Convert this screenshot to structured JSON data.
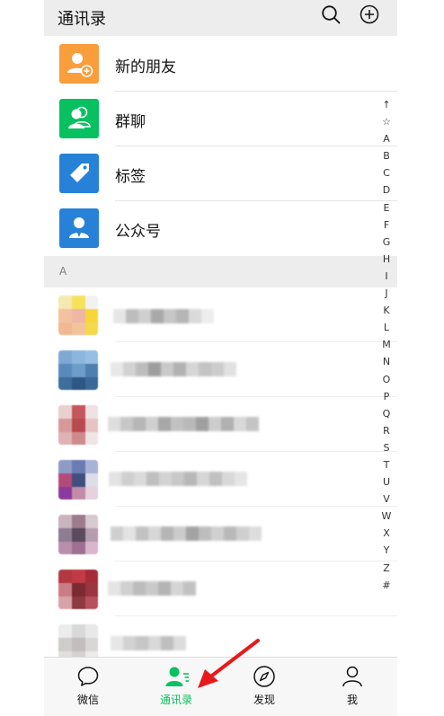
{
  "header": {
    "title": "通讯录",
    "search_icon": "search-icon",
    "add_icon": "add-circle-icon"
  },
  "functions": [
    {
      "label": "新的朋友",
      "color": "#fa9d3b",
      "icon": "add-friend-icon"
    },
    {
      "label": "群聊",
      "color": "#07c160",
      "icon": "group-icon"
    },
    {
      "label": "标签",
      "color": "#2782d7",
      "icon": "tag-icon"
    },
    {
      "label": "公众号",
      "color": "#2782d7",
      "icon": "official-account-icon"
    }
  ],
  "section": {
    "letter": "A"
  },
  "index_bar": [
    "↑",
    "☆",
    "A",
    "B",
    "C",
    "D",
    "E",
    "F",
    "G",
    "H",
    "I",
    "J",
    "K",
    "L",
    "M",
    "N",
    "O",
    "P",
    "Q",
    "R",
    "S",
    "T",
    "U",
    "V",
    "W",
    "X",
    "Y",
    "Z",
    "#"
  ],
  "tabs": [
    {
      "label": "微信",
      "icon": "chat-icon",
      "active": false
    },
    {
      "label": "通讯录",
      "icon": "contacts-icon",
      "active": true
    },
    {
      "label": "发现",
      "icon": "compass-icon",
      "active": false
    },
    {
      "label": "我",
      "icon": "me-icon",
      "active": false
    }
  ],
  "colors": {
    "accent": "#07c160",
    "annotation": "#e8191c"
  }
}
